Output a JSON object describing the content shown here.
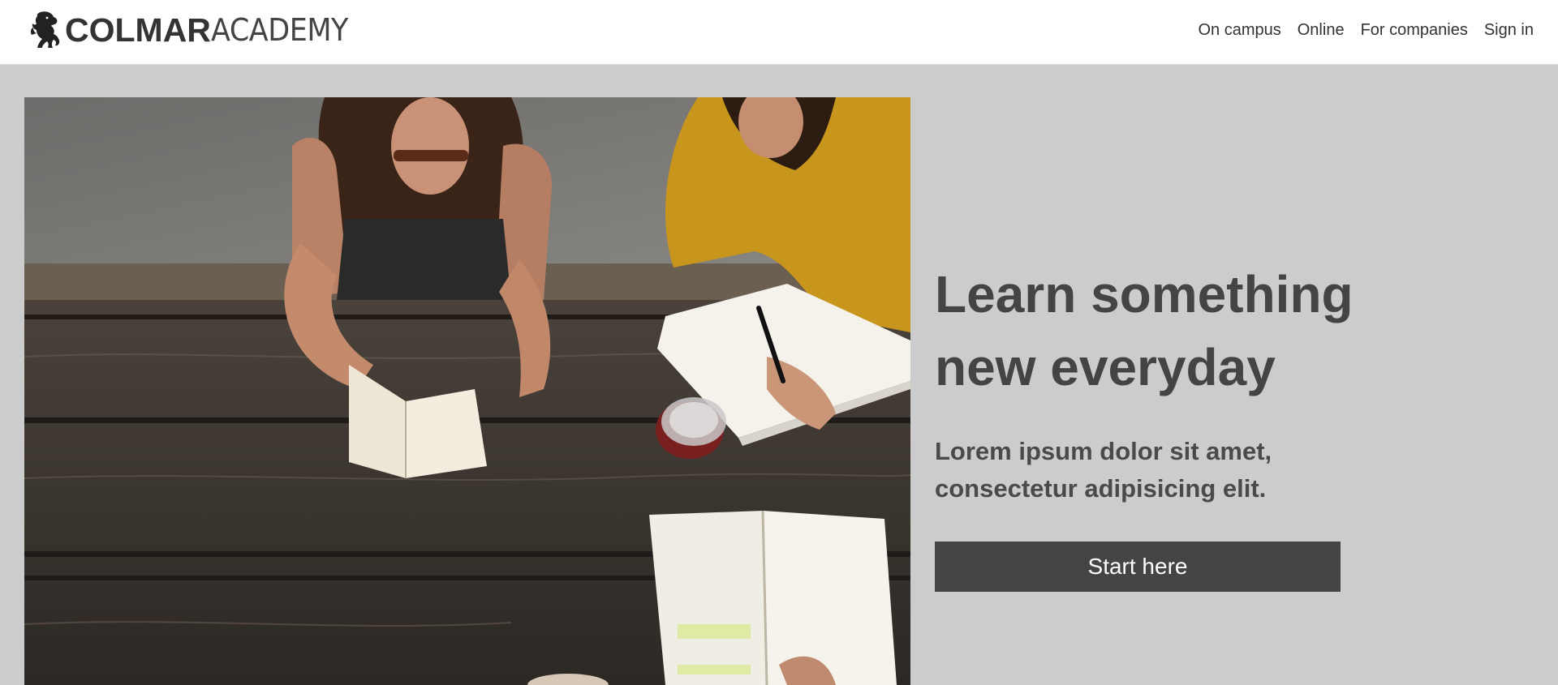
{
  "brand": {
    "name_bold": "COLMAR",
    "name_light": "ACADEMY",
    "logo_icon": "lion-rampant-icon"
  },
  "nav": {
    "items": [
      {
        "label": "On campus"
      },
      {
        "label": "Online"
      },
      {
        "label": "For companies"
      },
      {
        "label": "Sign in"
      }
    ]
  },
  "hero": {
    "image": "students-studying-at-picnic-table-photo",
    "headline": "Learn something new everyday",
    "subtext": "Lorem ipsum dolor sit amet, consectetur adipisicing elit.",
    "cta_label": "Start here"
  },
  "colors": {
    "page_background": "#cccccc",
    "header_background": "#ffffff",
    "text_dark": "#444444",
    "button_background": "#444444",
    "button_text": "#ffffff"
  }
}
